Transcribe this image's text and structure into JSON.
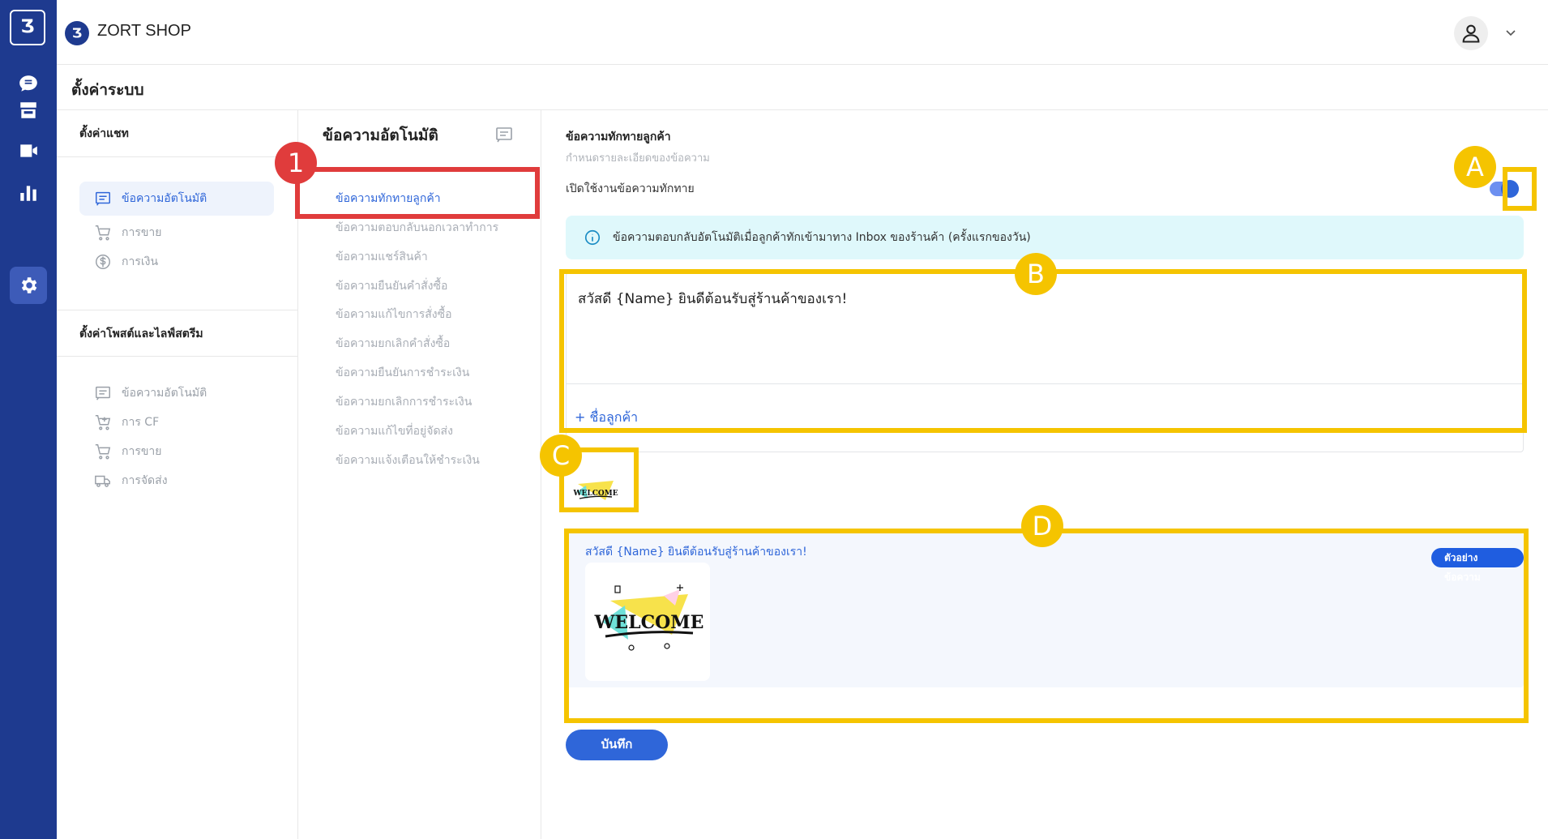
{
  "rail": {
    "logo": "Ʒ",
    "icons": [
      "chat-icon",
      "store-icon",
      "video-icon",
      "chart-icon",
      "settings-icon"
    ]
  },
  "header": {
    "shop_logo": "Ʒ",
    "shop_name": "ZORT SHOP"
  },
  "page": {
    "title": "ตั้งค่าระบบ"
  },
  "settings": {
    "chat_section": "ตั้งค่าแชท",
    "chat_items": [
      {
        "label": "ข้อความอัตโนมัติ",
        "icon": "message-icon",
        "active": true
      },
      {
        "label": "การขาย",
        "icon": "cart-icon"
      },
      {
        "label": "การเงิน",
        "icon": "dollar-icon"
      }
    ],
    "post_section": "ตั้งค่าโพสต์และไลฟ์สตรีม",
    "post_items": [
      {
        "label": "ข้อความอัตโนมัติ",
        "icon": "message-icon"
      },
      {
        "label": "การ CF",
        "icon": "cart-plus-icon"
      },
      {
        "label": "การขาย",
        "icon": "cart-icon"
      },
      {
        "label": "การจัดส่ง",
        "icon": "truck-icon"
      }
    ]
  },
  "messages": {
    "title": "ข้อความอัตโนมัติ",
    "items": [
      "ข้อความทักทายลูกค้า",
      "ข้อความตอบกลับนอกเวลาทำการ",
      "ข้อความแชร์สินค้า",
      "ข้อความยืนยันคำสั่งซื้อ",
      "ข้อความแก้ไขการสั่งซื้อ",
      "ข้อความยกเลิกคำสั่งซื้อ",
      "ข้อความยืนยันการชำระเงิน",
      "ข้อความยกเลิกการชำระเงิน",
      "ข้อความแก้ไขที่อยู่จัดส่ง",
      "ข้อความแจ้งเตือนให้ชำระเงิน"
    ]
  },
  "content": {
    "title": "ข้อความทักทายลูกค้า",
    "subtitle": "กำหนดรายละเอียดของข้อความ",
    "toggle_label": "เปิดใช้งานข้อความทักทาย",
    "toggle_on": true,
    "info": "ข้อความตอบกลับอัตโนมัติเมื่อลูกค้าทักเข้ามาทาง Inbox ของร้านค้า (ครั้งแรกของวัน)",
    "message": "สวัสดี {Name} ยินดีต้อนรับสู่ร้านค้าของเรา!",
    "add_name": "+ ชื่อลูกค้า",
    "image_text": "WELCOME",
    "preview_text": "สวัสดี {Name} ยินดีต้อนรับสู่ร้านค้าของเรา!",
    "preview_badge": "ตัวอย่างข้อความ",
    "save": "บันทึก"
  },
  "annotations": {
    "step1": "1",
    "a": "A",
    "b": "B",
    "c": "C",
    "d": "D",
    "box_color": "#f5c400",
    "step_color": "#e03c3c"
  }
}
